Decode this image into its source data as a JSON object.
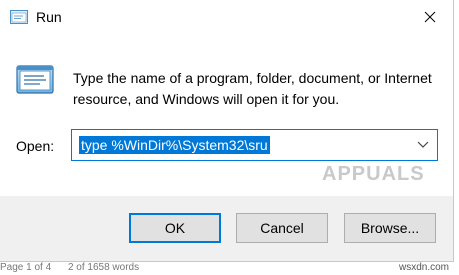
{
  "window": {
    "title": "Run",
    "title_icon": "run-icon",
    "close_icon": "close-icon"
  },
  "body": {
    "icon": "run-icon",
    "description": "Type the name of a program, folder, document, or Internet resource, and Windows will open it for you."
  },
  "open_field": {
    "label": "Open:",
    "value": "type %WinDir%\\System32\\sru",
    "dropdown_icon": "chevron-down-icon"
  },
  "watermark": "APPUALS",
  "buttons": {
    "ok": "OK",
    "cancel": "Cancel",
    "browse": "Browse..."
  },
  "background": {
    "page_info": "Page 1 of 4",
    "word_count": "2 of 1658 words",
    "site": "wsxdn.com"
  },
  "colors": {
    "accent": "#0078d7",
    "footer_bg": "#f0f0f0",
    "button_bg": "#e1e1e1"
  }
}
